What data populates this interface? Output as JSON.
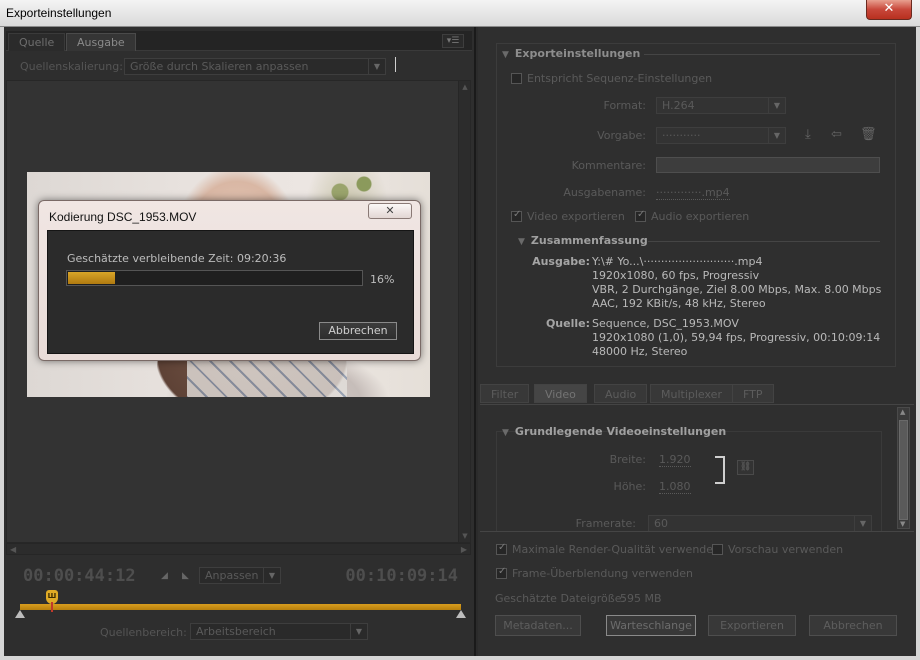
{
  "window": {
    "title": "Exporteinstellungen",
    "close_glyph": "✕"
  },
  "left": {
    "tabs": [
      "Quelle",
      "Ausgabe"
    ],
    "source_scaling_label": "Quellenskalierung:",
    "source_scaling_value": "Größe durch Skalieren anpassen",
    "timecode_current": "00:00:44:12",
    "timecode_duration": "00:10:09:14",
    "zoom_value": "Anpassen",
    "source_range_label": "Quellenbereich:",
    "source_range_value": "Arbeitsbereich"
  },
  "encoding_dialog": {
    "title": "Kodierung DSC_1953.MOV",
    "close_glyph": "✕",
    "remaining_label": "Geschätzte verbleibende Zeit: 09:20:36",
    "progress_fraction": 0.16,
    "progress_pct": "16%",
    "cancel_label": "Abbrechen"
  },
  "export": {
    "section_title": "Exporteinstellungen",
    "match_sequence_label": "Entspricht Sequenz-Einstellungen",
    "format_label": "Format:",
    "format_value": "H.264",
    "preset_label": "Vorgabe:",
    "preset_value": "···········",
    "comments_label": "Kommentare:",
    "output_name_label": "Ausgabename:",
    "output_name_value": "·············.mp4",
    "export_video_label": "Video exportieren",
    "export_audio_label": "Audio exportieren",
    "summary_title": "Zusammenfassung",
    "output_key": "Ausgabe:",
    "output_lines": [
      "Y:\\# Yo...\\··························.mp4",
      "1920x1080, 60 fps, Progressiv",
      "VBR, 2 Durchgänge, Ziel 8.00 Mbps, Max. 8.00 Mbps",
      "AAC, 192 KBit/s, 48 kHz, Stereo"
    ],
    "source_key": "Quelle:",
    "source_lines": [
      "Sequence, DSC_1953.MOV",
      "1920x1080 (1,0), 59,94 fps, Progressiv, 00:10:09:14",
      "48000 Hz, Stereo"
    ]
  },
  "subtabs": [
    "Filter",
    "Video",
    "Audio",
    "Multiplexer",
    "FTP"
  ],
  "video_settings": {
    "section_title": "Grundlegende Videoeinstellungen",
    "width_label": "Breite:",
    "width_value": "1.920",
    "height_label": "Höhe:",
    "height_value": "1.080",
    "framerate_label": "Framerate:",
    "framerate_value": "60"
  },
  "bottom": {
    "max_render_label": "Maximale Render-Qualität verwenden",
    "preview_label": "Vorschau verwenden",
    "frame_blend_label": "Frame-Überblendung verwenden",
    "file_size_label": "Geschätzte Dateigröße:",
    "file_size_value": "595 MB",
    "buttons": {
      "metadata": "Metadaten...",
      "queue": "Warteschlange",
      "export": "Exportieren",
      "cancel": "Abbrechen"
    }
  }
}
